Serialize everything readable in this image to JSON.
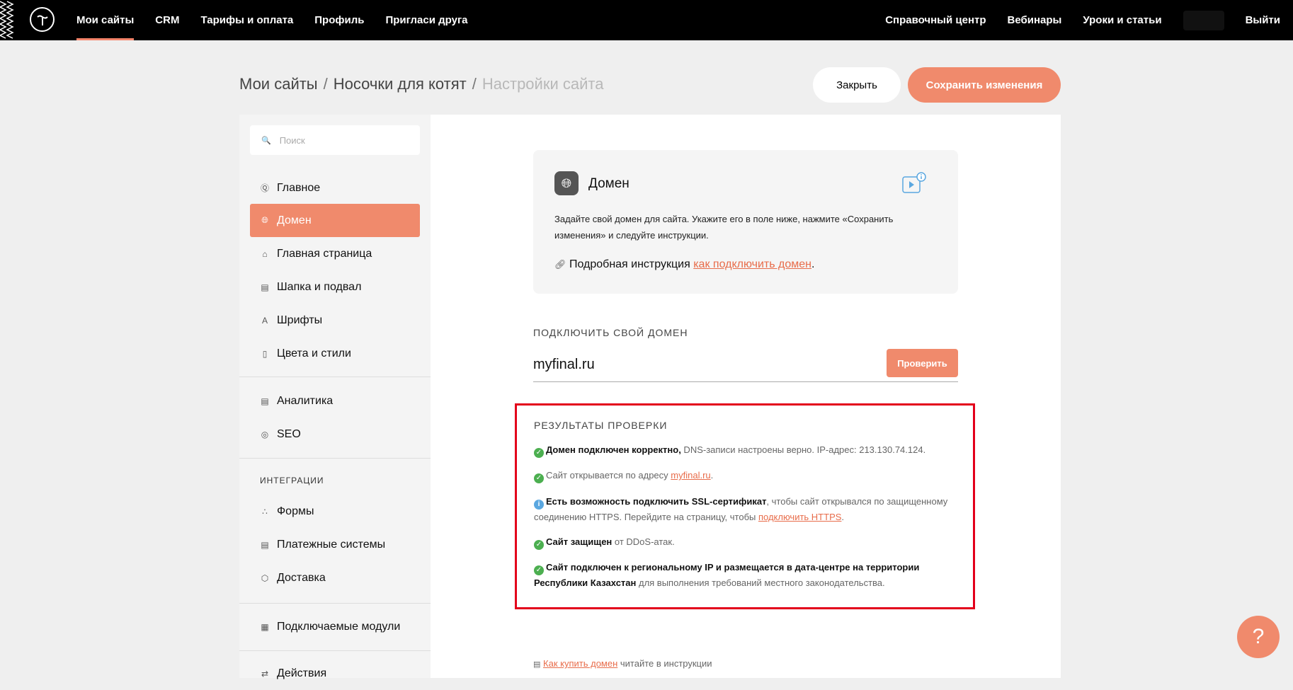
{
  "topbar": {
    "nav_left": [
      "Мои сайты",
      "CRM",
      "Тарифы и оплата",
      "Профиль",
      "Пригласи друга"
    ],
    "nav_right": [
      "Справочный центр",
      "Вебинары",
      "Уроки и статьи"
    ],
    "logout_label": "Выйти",
    "logo_letter": "Т",
    "active_color": "#f4846a"
  },
  "header": {
    "breadcrumb": [
      "Мои сайты",
      "Носочки для котят",
      "Настройки сайта"
    ],
    "separator": "/",
    "close_label": "Закрыть",
    "save_label": "Сохранить изменения",
    "accent_color": "#f08a6c"
  },
  "sidebar": {
    "search_placeholder": "Поиск",
    "items": [
      {
        "label": "Главное",
        "icon": "tilda-icon"
      },
      {
        "label": "Домен",
        "icon": "globe-icon",
        "active": true
      },
      {
        "label": "Главная страница",
        "icon": "home-icon"
      },
      {
        "label": "Шапка и подвал",
        "icon": "layout-icon"
      },
      {
        "label": "Шрифты",
        "icon": "font-icon"
      },
      {
        "label": "Цвета и стили",
        "icon": "brush-icon"
      },
      {
        "label": "Аналитика",
        "icon": "chart-icon"
      },
      {
        "label": "SEO",
        "icon": "target-icon"
      },
      {
        "label": "Формы",
        "icon": "forms-icon"
      },
      {
        "label": "Платежные системы",
        "icon": "card-icon"
      },
      {
        "label": "Доставка",
        "icon": "box-icon"
      },
      {
        "label": "Подключаемые модули",
        "icon": "modules-icon"
      },
      {
        "label": "Действия",
        "icon": "arrows-icon"
      }
    ],
    "integrations_title": "ИНТЕГРАЦИИ"
  },
  "domain_card": {
    "title": "Домен",
    "description": "Задайте свой домен для сайта. Укажите его в поле ниже, нажмите «Сохранить изменения» и следуйте инструкции.",
    "instruction_prefix": "Подробная инструкция",
    "instruction_link": "как подключить домен",
    "instruction_suffix": "."
  },
  "connect": {
    "label": "ПОДКЛЮЧИТЬ СВОЙ ДОМЕН",
    "value": "myfinal.ru",
    "check_label": "Проверить"
  },
  "results": {
    "title": "РЕЗУЛЬТАТЫ ПРОВЕРКИ",
    "r1_bold": "Домен подключен корректно,",
    "r1_text": " DNS-записи настроены верно. IP-адрес: 213.130.74.124.",
    "r2_text": "Сайт открывается по адресу ",
    "r2_link": "myfinal.ru",
    "r2_suffix": ".",
    "r3_bold": "Есть возможность подключить SSL-сертификат",
    "r3_text": ", чтобы сайт открывался по защищенному соединению HTTPS. Перейдите на страницу, чтобы ",
    "r3_link": "подключить HTTPS",
    "r3_suffix": ".",
    "r4_bold": "Сайт защищен",
    "r4_text": " от DDoS-атак.",
    "r5_bold": "Сайт подключен к региональному IP и размещается в дата-центре на территории Республики Казахстан",
    "r5_text": " для выполнения требований местного законодательства.",
    "highlight_color": "#e3001b"
  },
  "footer_note": {
    "link": "Как купить домен",
    "text": " читайте в инструкции"
  },
  "help": {
    "symbol": "?"
  }
}
